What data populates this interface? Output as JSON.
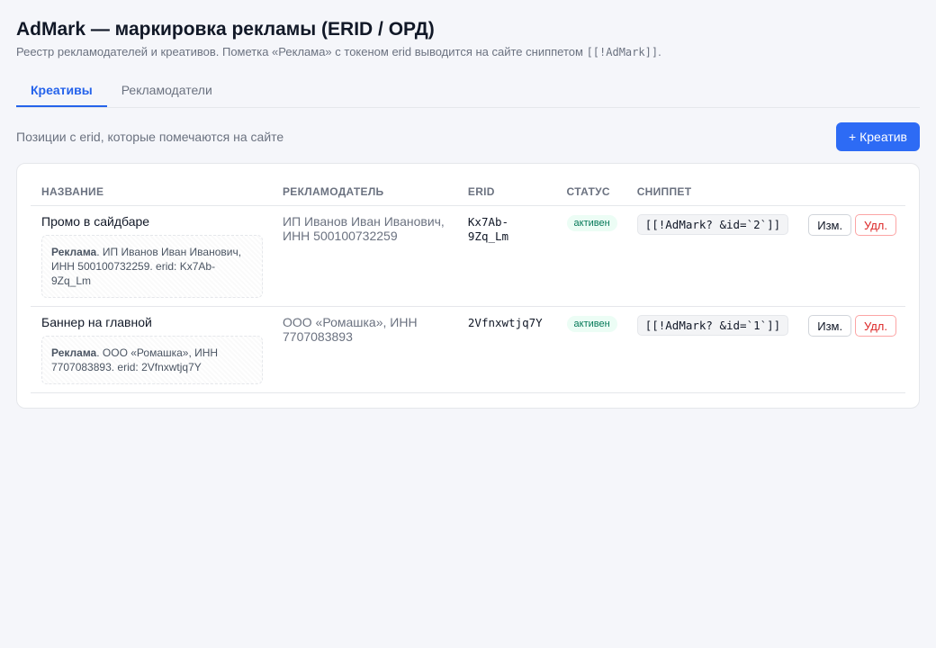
{
  "header": {
    "title": "AdMark — маркировка рекламы (ERID / ОРД)",
    "subtitle_text": "Реестр рекламодателей и креативов. Пометка «Реклама» с токеном erid выводится на сайте сниппетом",
    "subtitle_code": "[[!AdMark]]",
    "subtitle_end": "."
  },
  "tabs": [
    {
      "label": "Креативы",
      "active": true
    },
    {
      "label": "Рекламодатели",
      "active": false
    }
  ],
  "toolbar": {
    "description": "Позиции с erid, которые помечаются на сайте",
    "add_label": "+ Креатив"
  },
  "table": {
    "columns": [
      "НАЗВАНИЕ",
      "РЕКЛАМОДАТЕЛЬ",
      "ERID",
      "СТАТУС",
      "СНИППЕТ",
      ""
    ],
    "rows": [
      {
        "name": "Промо в сайдбаре",
        "preview_label": "Реклама",
        "preview_text": ". ИП Иванов Иван Иванович, ИНН 500100732259. erid: Kx7Ab-9Zq_Lm",
        "advertiser": "ИП Иванов Иван Иванович, ИНН 500100732259",
        "erid": "Kx7Ab-9Zq_Lm",
        "status": "активен",
        "snippet": "[[!AdMark? &id=`2`]]",
        "edit_label": "Изм.",
        "delete_label": "Удл."
      },
      {
        "name": "Баннер на главной",
        "preview_label": "Реклама",
        "preview_text": ". ООО «Ромашка», ИНН 7707083893. erid: 2Vfnxwtjq7Y",
        "advertiser": "ООО «Ромашка», ИНН 7707083893",
        "erid": "2Vfnxwtjq7Y",
        "status": "активен",
        "snippet": "[[!AdMark? &id=`1`]]",
        "edit_label": "Изм.",
        "delete_label": "Удл."
      }
    ]
  },
  "colors": {
    "accent": "#2d6bf5",
    "active_badge_bg": "#ecfdf5",
    "active_badge_text": "#047857",
    "danger": "#dc2626"
  }
}
